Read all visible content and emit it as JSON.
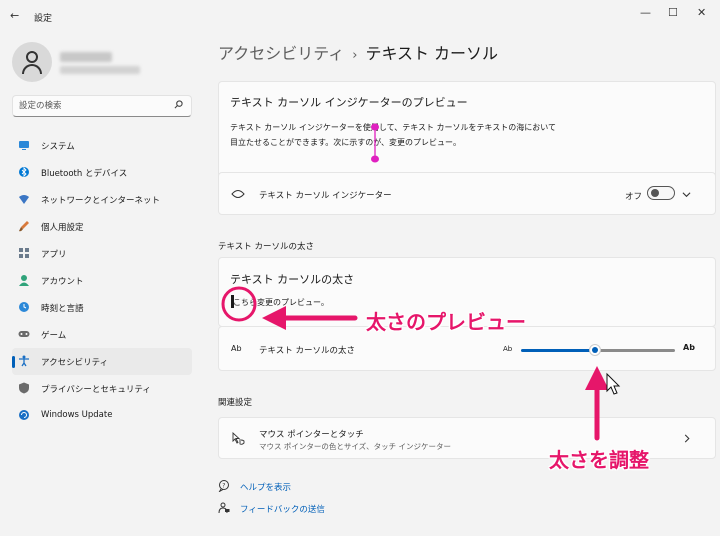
{
  "window": {
    "title": "設定",
    "back_glyph": "←",
    "minimize_glyph": "—",
    "maximize_glyph": "☐",
    "close_glyph": "✕"
  },
  "search": {
    "placeholder": "設定の検索",
    "icon": "search-icon"
  },
  "sidebar": {
    "items": [
      {
        "label": "システム",
        "icon": "system-icon",
        "color": "#2b88d8"
      },
      {
        "label": "Bluetooth とデバイス",
        "icon": "bluetooth-icon",
        "color": "#0078d4"
      },
      {
        "label": "ネットワークとインターネット",
        "icon": "network-icon",
        "color": "#3b76c4"
      },
      {
        "label": "個人用設定",
        "icon": "brush-icon",
        "color": "#d87a3c"
      },
      {
        "label": "アプリ",
        "icon": "apps-icon",
        "color": "#6b7b8c"
      },
      {
        "label": "アカウント",
        "icon": "account-icon",
        "color": "#2fa37a"
      },
      {
        "label": "時刻と言語",
        "icon": "time-language-icon",
        "color": "#2b88d8"
      },
      {
        "label": "ゲーム",
        "icon": "gaming-icon",
        "color": "#6b6b6b"
      },
      {
        "label": "アクセシビリティ",
        "icon": "accessibility-icon",
        "color": "#1a6fc4",
        "active": true
      },
      {
        "label": "プライバシーとセキュリティ",
        "icon": "shield-icon",
        "color": "#6b6b6b"
      },
      {
        "label": "Windows Update",
        "icon": "windows-update-icon",
        "color": "#1a6fc4"
      }
    ]
  },
  "breadcrumb": {
    "parent": "アクセシビリティ",
    "separator": "›",
    "current": "テキスト カーソル"
  },
  "indicator_preview": {
    "title": "テキスト カーソル インジケーターのプレビュー",
    "line1": "テキスト カーソル インジケーターを使用して、テキスト カーソルをテキストの海において",
    "line2": "目立たせることができます。次に示すのが、変更のプレビュー。"
  },
  "indicator_toggle": {
    "label": "テキスト カーソル インジケーター",
    "state": "オフ",
    "on": false,
    "icon": "indicator-icon"
  },
  "thickness_section": {
    "label": "テキスト カーソルの太さ"
  },
  "thickness_preview": {
    "title": "テキスト カーソルの太さ",
    "text": "こちら変更のプレビュー。"
  },
  "thickness_setting": {
    "label": "テキスト カーソルの太さ",
    "icon_text": "Ab",
    "small_label": "Ab",
    "large_label": "Ab",
    "value_fraction": 0.49
  },
  "related": {
    "section_label": "関連設定",
    "mouse": {
      "title": "マウス ポインターとタッチ",
      "subtitle": "マウス ポインターの色とサイズ、タッチ インジケーター",
      "icon": "mouse-touch-icon"
    }
  },
  "links": {
    "help": "ヘルプを表示",
    "feedback": "フィードバックの送信"
  },
  "annotations": {
    "preview_callout": "太さのプレビュー",
    "adjust_callout": "太さを調整",
    "color": "#e6166a"
  }
}
